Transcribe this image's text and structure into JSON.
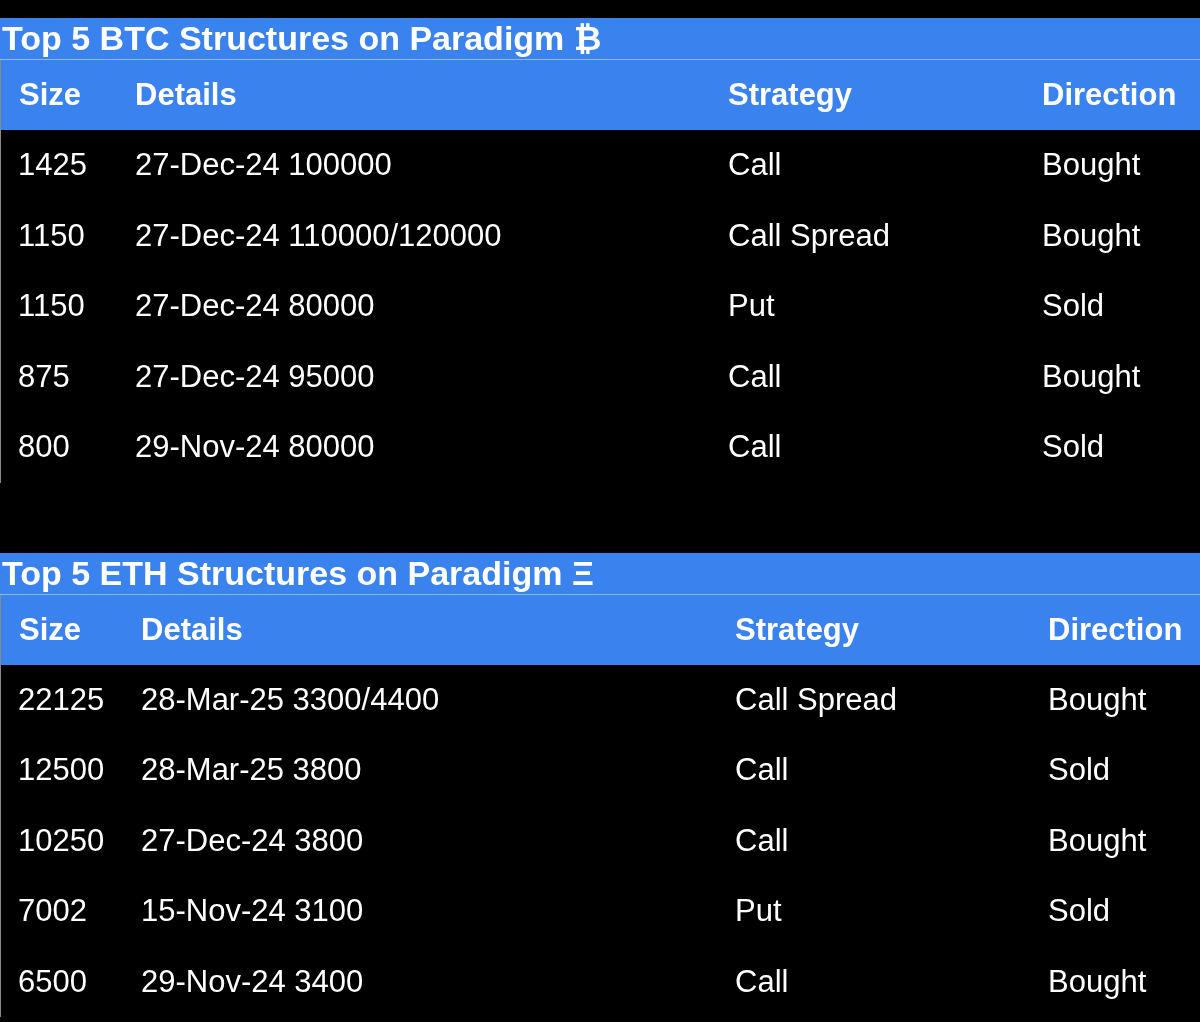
{
  "tables": [
    {
      "title": "Top 5 BTC Structures on Paradigm ₿",
      "columns": [
        "Size",
        "Details",
        "Strategy",
        "Direction"
      ],
      "rows": [
        [
          "1425",
          "27-Dec-24 100000",
          "Call",
          "Bought"
        ],
        [
          "1150",
          "27-Dec-24 110000/120000",
          "Call Spread",
          "Bought"
        ],
        [
          "1150",
          "27-Dec-24 80000",
          "Put",
          "Sold"
        ],
        [
          "875",
          "27-Dec-24 95000",
          "Call",
          "Bought"
        ],
        [
          "800",
          "29-Nov-24 80000",
          "Call",
          "Sold"
        ]
      ]
    },
    {
      "title": "Top 5 ETH Structures on Paradigm Ξ",
      "columns": [
        "Size",
        "Details",
        "Strategy",
        "Direction"
      ],
      "rows": [
        [
          "22125",
          "28-Mar-25 3300/4400",
          "Call Spread",
          "Bought"
        ],
        [
          "12500",
          "28-Mar-25 3800",
          "Call",
          "Sold"
        ],
        [
          "10250",
          "27-Dec-24 3800",
          "Call",
          "Bought"
        ],
        [
          "7002",
          "15-Nov-24 3100",
          "Put",
          "Sold"
        ],
        [
          "6500",
          "29-Nov-24 3400",
          "Call",
          "Bought"
        ]
      ]
    }
  ]
}
